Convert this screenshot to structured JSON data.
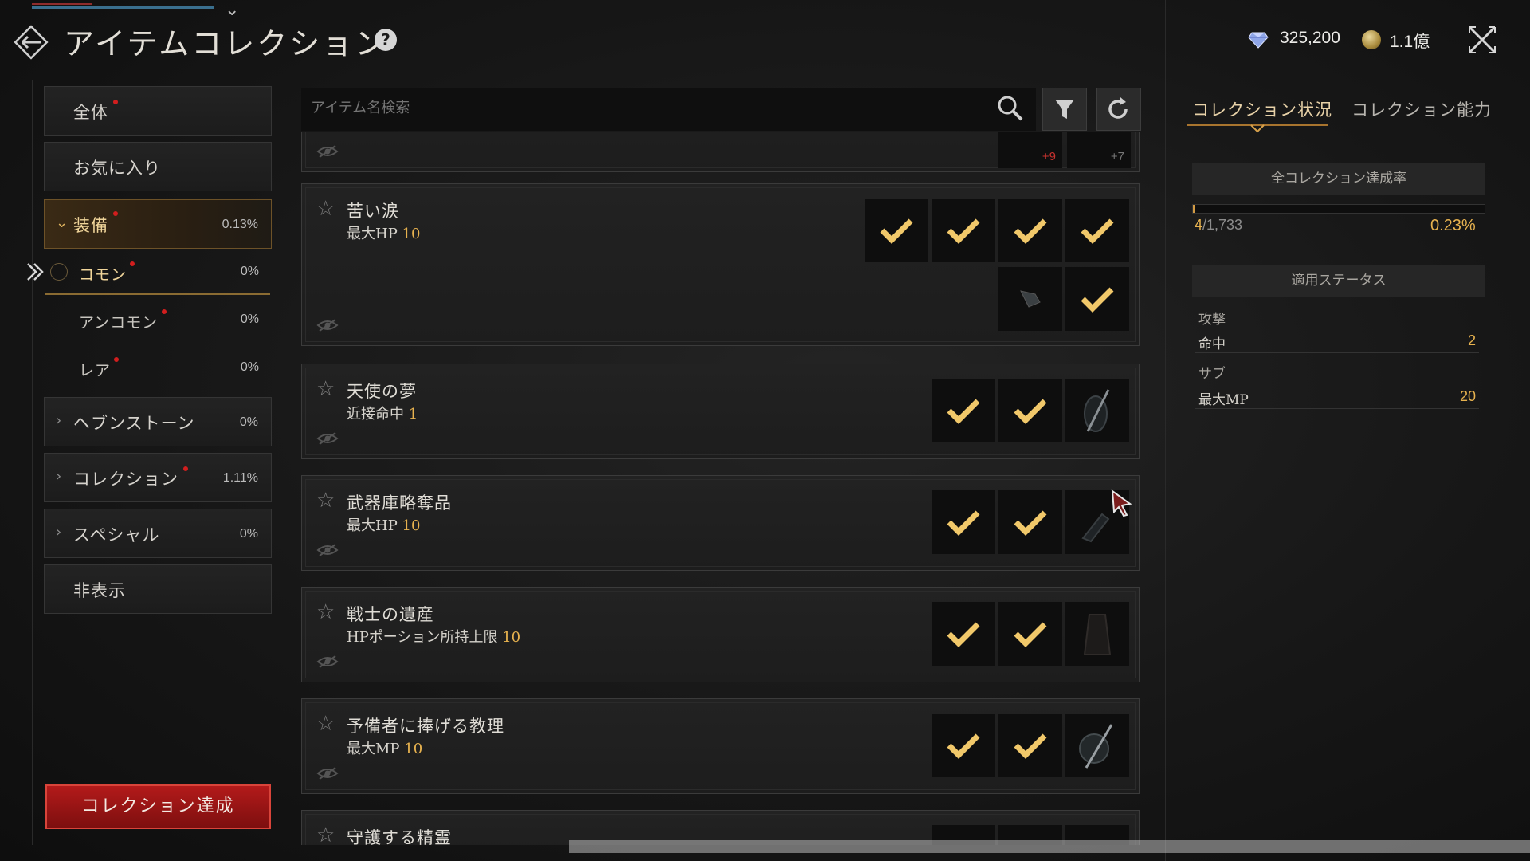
{
  "header": {
    "title": "アイテムコレクション",
    "help_icon": "?",
    "gem_value": "325,200",
    "coin_value": "1.1億"
  },
  "sidebar": {
    "all": "全体",
    "favorites": "お気に入り",
    "equipment": {
      "label": "装備",
      "pct": "0.13%"
    },
    "sub": [
      {
        "label": "コモン",
        "pct": "0%"
      },
      {
        "label": "アンコモン",
        "pct": "0%"
      },
      {
        "label": "レア",
        "pct": "0%"
      }
    ],
    "heavenstone": {
      "label": "ヘブンストーン",
      "pct": "0%"
    },
    "collection": {
      "label": "コレクション",
      "pct": "1.11%"
    },
    "special": {
      "label": "スペシャル",
      "pct": "0%"
    },
    "hidden": "非表示",
    "achieve_button": "コレクション達成"
  },
  "search": {
    "placeholder": "アイテム名検索"
  },
  "list": {
    "partial_top": {
      "enchant_a": "+9",
      "enchant_b": "+7"
    },
    "items": [
      {
        "name": "苦い涙",
        "stat": "最大HP",
        "value": "10"
      },
      {
        "name": "天使の夢",
        "stat": "近接命中",
        "value": "1"
      },
      {
        "name": "武器庫略奪品",
        "stat": "最大HP",
        "value": "10"
      },
      {
        "name": "戦士の遺産",
        "stat": "HPポーション所持上限",
        "value": "10"
      },
      {
        "name": "予備者に捧げる教理",
        "stat": "最大MP",
        "value": "10"
      },
      {
        "name": "守護する精霊",
        "stat": "",
        "value": ""
      }
    ]
  },
  "right_panel": {
    "tab_status": "コレクション状況",
    "tab_ability": "コレクション能力",
    "rate_header": "全コレクション達成率",
    "rate_current": "4",
    "rate_total": "/1,733",
    "rate_fraction": 0.0023,
    "rate_pct": "0.23%",
    "applied_header": "適用ステータス",
    "cat_attack": "攻撃",
    "cat_sub": "サブ",
    "stats": [
      {
        "name": "命中",
        "value": "2"
      },
      {
        "name": "最大MP",
        "value": "20"
      }
    ]
  },
  "colors": {
    "accent_gold": "#e7b24f",
    "achieve_red": "#b31a1a",
    "notify_dot": "#d21e1e"
  }
}
